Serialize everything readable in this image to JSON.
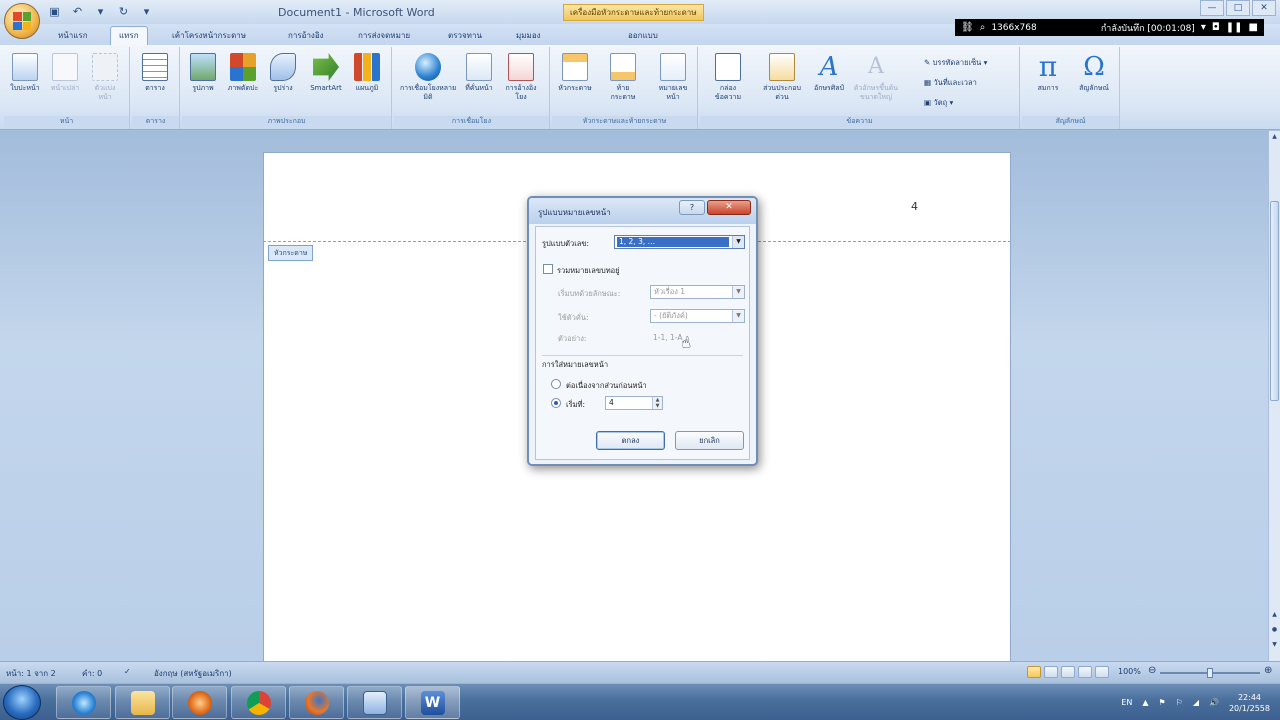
{
  "window": {
    "title": "Document1 - Microsoft Word",
    "contextual_tab_title": "เครื่องมือหัวกระดาษและท้ายกระดาษ",
    "controls": [
      "—",
      "□",
      "✕"
    ]
  },
  "recording_bar": {
    "size_text": "1366x768",
    "status_text": "กำลังบันทึก [00:01:08]"
  },
  "tabs": [
    {
      "label": "หน้าแรก",
      "active": false
    },
    {
      "label": "แทรก",
      "active": true
    },
    {
      "label": "เค้าโครงหน้ากระดาษ",
      "active": false
    },
    {
      "label": "การอ้างอิง",
      "active": false
    },
    {
      "label": "การส่งจดหมาย",
      "active": false
    },
    {
      "label": "ตรวจทาน",
      "active": false
    },
    {
      "label": "มุมมอง",
      "active": false
    },
    {
      "label": "ออกแบบ",
      "active": false
    }
  ],
  "ribbon": {
    "groups": {
      "pages": {
        "label": "หน้า",
        "buttons": [
          "ใบปะหน้า",
          "หน้าเปล่า",
          "ตัวแบ่งหน้า"
        ]
      },
      "tables": {
        "label": "ตาราง",
        "buttons": [
          "ตาราง"
        ]
      },
      "illustrations": {
        "label": "ภาพประกอบ",
        "buttons": [
          "รูปภาพ",
          "ภาพตัดปะ",
          "รูปร่าง",
          "SmartArt",
          "แผนภูมิ"
        ]
      },
      "links": {
        "label": "การเชื่อมโยง",
        "buttons": [
          "การเชื่อมโยงหลายมิติ",
          "ที่คั่นหน้า",
          "การอ้างอิงโยง"
        ]
      },
      "header_footer": {
        "label": "หัวกระดาษและท้ายกระดาษ",
        "buttons": [
          "หัวกระดาษ",
          "ท้ายกระดาษ",
          "หมายเลขหน้า"
        ]
      },
      "text": {
        "label": "ข้อความ",
        "buttons": [
          "กล่องข้อความ",
          "ส่วนประกอบด่วน",
          "อักษรศิลป์",
          "ตัวอักษรขึ้นต้นขนาดใหญ่"
        ],
        "small_buttons": [
          "บรรทัดลายเซ็น",
          "วันที่และเวลา",
          "วัตถุ"
        ]
      },
      "symbols": {
        "label": "สัญลักษณ์",
        "buttons": [
          "สมการ",
          "สัญลักษณ์"
        ]
      }
    }
  },
  "document": {
    "page_number": "4",
    "header_tag": "หัวกระดาษ"
  },
  "dialog": {
    "title": "รูปแบบหมายเลขหน้า",
    "help": "?",
    "close": "✕",
    "number_format_label": "รูปแบบตัวเลข:",
    "number_format_value": "1, 2, 3, …",
    "include_chapter_label": "รวมหมายเลขบทอยู่",
    "chapter_style_label": "เริ่มบทด้วยลักษณะ:",
    "chapter_style_value": "หัวเรื่อง 1",
    "separator_label": "ใช้ตัวคั่น:",
    "separator_value": "-   (ยัติภังค์)",
    "examples_label": "ตัวอย่าง:",
    "examples_value": "1-1, 1-A",
    "page_numbering_label": "การใส่หมายเลขหน้า",
    "continue_label": "ต่อเนื่องจากส่วนก่อนหน้า",
    "start_at_label": "เริ่มที่:",
    "start_at_value": "4",
    "ok": "ตกลง",
    "cancel": "ยกเลิก"
  },
  "statusbar": {
    "page": "หน้า: 1 จาก 2",
    "words": "คำ: 0",
    "language": "อังกฤษ (สหรัฐอเมริกา)",
    "zoom": "100%"
  },
  "taskbar": {
    "language": "EN",
    "time": "22:44",
    "date": "20/1/2558",
    "apps": [
      "ie-icon",
      "explorer-icon",
      "media-player-icon",
      "chrome-icon",
      "firefox-icon",
      "network-icon",
      "word-icon"
    ]
  }
}
